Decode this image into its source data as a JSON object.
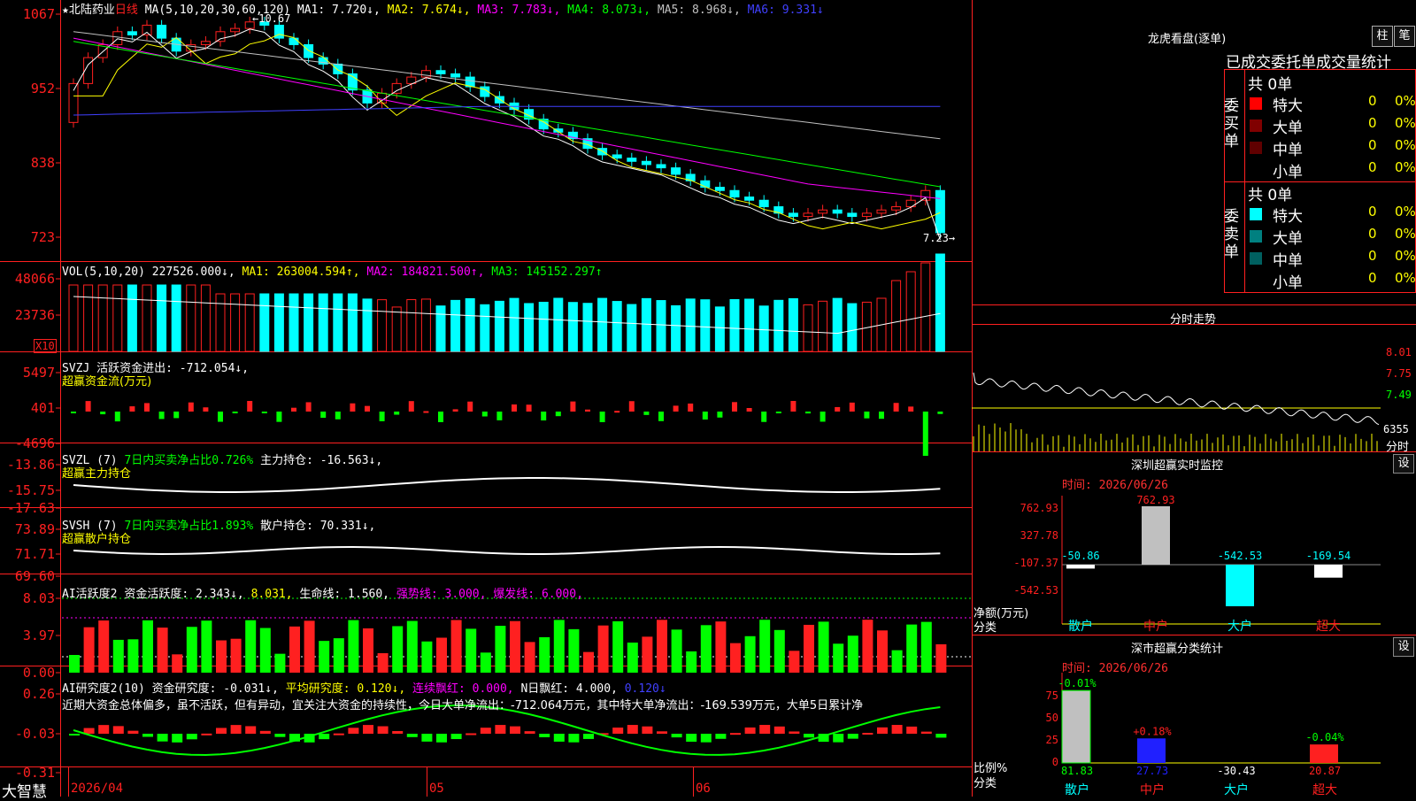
{
  "stock": {
    "star": "★",
    "name": "北陆药业",
    "period": "日线",
    "ma_label": "MA(5,10,20,30,60,120)",
    "ma_values": [
      {
        "text": "MA1: 7.720↓,",
        "color": "#ffffff"
      },
      {
        "text": "MA2: 7.674↓,",
        "color": "#ffff00"
      },
      {
        "text": "MA3: 7.783↓,",
        "color": "#ff00ff"
      },
      {
        "text": "MA4: 8.073↓,",
        "color": "#00ff00"
      },
      {
        "text": "MA5: 8.968↓,",
        "color": "#c0c0c0"
      },
      {
        "text": "MA6: 9.331↓",
        "color": "#4040ff"
      }
    ],
    "high_label": "←10.67",
    "low_label": "7.23→"
  },
  "price_axis": [
    "1067",
    "952",
    "838",
    "723"
  ],
  "volume": {
    "axis": [
      "48066",
      "23736"
    ],
    "unit": "X10",
    "header": [
      {
        "text": "VOL(5,10,20)",
        "color": "#ffffff"
      },
      {
        "text": "227526.000↓,",
        "color": "#ffffff"
      },
      {
        "text": "MA1: 263004.594↑,",
        "color": "#ffff00"
      },
      {
        "text": "MA2: 184821.500↑,",
        "color": "#ff00ff"
      },
      {
        "text": "MA3: 145152.297↑",
        "color": "#00ff00"
      }
    ]
  },
  "svzj": {
    "axis": [
      "5497",
      "401",
      "-4696"
    ],
    "header": "SVZJ  活跃资金进出: -712.054↓,",
    "subtitle": "超赢资金流(万元)"
  },
  "svzl": {
    "axis": [
      "-13.86",
      "-15.75",
      "-17.63"
    ],
    "header": [
      {
        "text": "SVZL (7)",
        "color": "#ffffff"
      },
      {
        "text": "7日内买卖净占比0.726%",
        "color": "#00ff00"
      },
      {
        "text": "主力持仓: -16.563↓,",
        "color": "#ffffff"
      }
    ],
    "subtitle": "超赢主力持仓"
  },
  "svsh": {
    "axis": [
      "73.89",
      "71.71",
      "69.60"
    ],
    "header": [
      {
        "text": "SVSH (7)",
        "color": "#ffffff"
      },
      {
        "text": "7日内买卖净占比1.893%",
        "color": "#00ff00"
      },
      {
        "text": "散户持仓: 70.331↓,",
        "color": "#ffffff"
      }
    ],
    "subtitle": "超赢散户持仓"
  },
  "ai_active": {
    "axis": [
      "8.03",
      "3.97",
      "0.00"
    ],
    "header": [
      {
        "text": "AI活跃度2",
        "color": "#ffffff"
      },
      {
        "text": "资金活跃度: 2.343↓,",
        "color": "#ffffff"
      },
      {
        "text": "8.031,",
        "color": "#ffff00"
      },
      {
        "text": "生命线: 1.560,",
        "color": "#ffffff"
      },
      {
        "text": "强势线: 3.000,",
        "color": "#ff00ff"
      },
      {
        "text": "爆发线: 6.000,",
        "color": "#ff00ff"
      }
    ]
  },
  "ai_research": {
    "axis": [
      "0.26",
      "-0.03",
      "-0.31"
    ],
    "header": [
      {
        "text": "AI研究度2(10)",
        "color": "#ffffff"
      },
      {
        "text": "资金研究度: -0.031↓,",
        "color": "#ffffff"
      },
      {
        "text": "平均研究度: 0.120↓,",
        "color": "#ffff00"
      },
      {
        "text": "连续飘红: 0.000,",
        "color": "#ff00ff"
      },
      {
        "text": "N日飘红: 4.000,",
        "color": "#ffffff"
      },
      {
        "text": "0.120↓",
        "color": "#4040ff"
      }
    ],
    "commentary": "近期大资金总体偏多，虽不活跃，但有异动，宜关注大资金的持续性，今日大单净流出：-712.064万元，其中特大单净流出：-169.539万元，大单5日累计净"
  },
  "date_axis": [
    "2026/04",
    "05",
    "06"
  ],
  "logo": "大智慧",
  "right_panel": {
    "lhkp": {
      "title": "龙虎看盘(逐单)",
      "btn_bar": "柱",
      "btn_pen": "笔",
      "stats_title": "已成交委托单成交量统计",
      "buy_label": "委买单",
      "sell_label": "委卖单",
      "buy_total": "共 0单",
      "sell_total": "共 0单",
      "buy_rows": [
        {
          "label": "特大",
          "value": "0",
          "pct": "0%",
          "color": "#ff0000"
        },
        {
          "label": "大单",
          "value": "0",
          "pct": "0%",
          "color": "#800000"
        },
        {
          "label": "中单",
          "value": "0",
          "pct": "0%",
          "color": "#600000"
        },
        {
          "label": "小单",
          "value": "0",
          "pct": "0%",
          "color": ""
        }
      ],
      "sell_rows": [
        {
          "label": "特大",
          "value": "0",
          "pct": "0%",
          "color": "#00ffff"
        },
        {
          "label": "大单",
          "value": "0",
          "pct": "0%",
          "color": "#008080"
        },
        {
          "label": "中单",
          "value": "0",
          "pct": "0%",
          "color": "#006060"
        },
        {
          "label": "小单",
          "value": "0",
          "pct": "0%",
          "color": ""
        }
      ]
    },
    "timeshare": {
      "title": "分时走势",
      "price_axis": [
        "8.01",
        "7.75",
        "7.49"
      ],
      "volume_label": "6355",
      "unit_label": "分时"
    },
    "sz_monitor": {
      "title": "深圳超赢实时监控",
      "gear": "设",
      "time": "时间: 2026/06/26",
      "axis": [
        "762.93",
        "327.78",
        "-107.37",
        "-542.53"
      ],
      "y_label": "净额(万元)",
      "x_label": "分类",
      "categories": [
        "散户",
        "中户",
        "大户",
        "超大"
      ],
      "values": [
        -50.86,
        762.93,
        -542.53,
        -169.54
      ],
      "value_labels": [
        "-50.86",
        "762.93",
        "-542.53",
        "-169.54"
      ]
    },
    "sz_classify": {
      "title": "深市超赢分类统计",
      "gear": "设",
      "time": "时间: 2026/06/26",
      "axis": [
        "75",
        "50",
        "25",
        "0"
      ],
      "y_label": "比例%",
      "x_label": "分类",
      "categories": [
        "散户",
        "中户",
        "大户",
        "超大"
      ],
      "top_labels": [
        "-0.01%",
        "+0.18%",
        "",
        "-0.04%"
      ],
      "bottom_labels": [
        "81.83",
        "27.73",
        "-30.43",
        "20.87"
      ],
      "values": [
        81.83,
        27.73,
        -30.43,
        20.87
      ]
    }
  }
}
